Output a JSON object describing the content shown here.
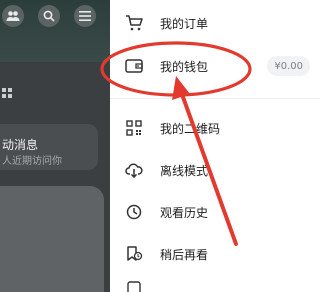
{
  "background_app": {
    "top_icons": [
      "people-icon",
      "search-icon",
      "menu-icon"
    ],
    "notification": {
      "title": "动消息",
      "subtitle": "人近期访问你"
    }
  },
  "drawer": {
    "items": [
      {
        "id": "orders",
        "label": "我的订单",
        "icon": "cart-icon"
      },
      {
        "id": "wallet",
        "label": "我的钱包",
        "icon": "wallet-icon",
        "badge": "¥0.00"
      },
      {
        "id": "qrcode",
        "label": "我的二维码",
        "icon": "qrcode-icon"
      },
      {
        "id": "offline",
        "label": "离线模式",
        "icon": "cloud-download-icon"
      },
      {
        "id": "history",
        "label": "观看历史",
        "icon": "clock-icon"
      },
      {
        "id": "watch-later",
        "label": "稍后再看",
        "icon": "bookmark-clock-icon"
      }
    ]
  },
  "colors": {
    "annotation_red": "#e23a2e",
    "overlay_bg": "#3b3f42",
    "text_primary": "#202020"
  }
}
